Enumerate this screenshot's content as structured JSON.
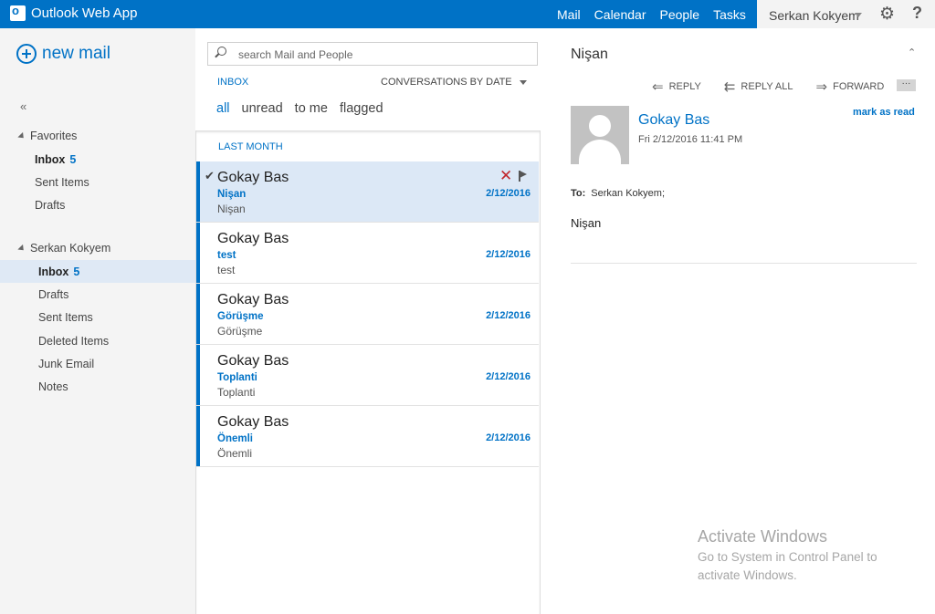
{
  "app": {
    "title": "Outlook Web App"
  },
  "nav": {
    "items": [
      "Mail",
      "Calendar",
      "People",
      "Tasks"
    ]
  },
  "user": {
    "name": "Serkan Kokyem"
  },
  "sidebar": {
    "new_mail": "new mail",
    "collapse": "«",
    "favorites": {
      "label": "Favorites",
      "items": [
        {
          "label": "Inbox",
          "count": "5"
        },
        {
          "label": "Sent Items"
        },
        {
          "label": "Drafts"
        }
      ]
    },
    "account": {
      "label": "Serkan Kokyem",
      "items": [
        {
          "label": "Inbox",
          "count": "5"
        },
        {
          "label": "Drafts"
        },
        {
          "label": "Sent Items"
        },
        {
          "label": "Deleted Items"
        },
        {
          "label": "Junk Email"
        },
        {
          "label": "Notes"
        }
      ]
    }
  },
  "search": {
    "placeholder": "search Mail and People"
  },
  "list_header": {
    "folder": "INBOX",
    "sort": "CONVERSATIONS BY DATE",
    "filters": [
      "all",
      "unread",
      "to me",
      "flagged"
    ]
  },
  "messages": {
    "group": "LAST MONTH",
    "items": [
      {
        "from": "Gokay Bas",
        "subject": "Nişan",
        "preview": "Nişan",
        "date": "2/12/2016"
      },
      {
        "from": "Gokay Bas",
        "subject": "test",
        "preview": "test",
        "date": "2/12/2016"
      },
      {
        "from": "Gokay Bas",
        "subject": "Görüşme",
        "preview": "Görüşme",
        "date": "2/12/2016"
      },
      {
        "from": "Gokay Bas",
        "subject": "Toplanti",
        "preview": "Toplanti",
        "date": "2/12/2016"
      },
      {
        "from": "Gokay Bas",
        "subject": "Önemli",
        "preview": "Önemli",
        "date": "2/12/2016"
      }
    ]
  },
  "reading": {
    "subject": "Nişan",
    "actions": {
      "reply": "REPLY",
      "reply_all": "REPLY ALL",
      "forward": "FORWARD",
      "more": "···"
    },
    "sender": "Gokay Bas",
    "date": "Fri 2/12/2016 11:41 PM",
    "mark_read": "mark as read",
    "to_label": "To:",
    "to_value": "Serkan Kokyem;",
    "body": "Nişan"
  },
  "watermark": {
    "title": "Activate Windows",
    "line": "Go to System in Control Panel to activate Windows."
  },
  "colors": {
    "accent": "#0072c6",
    "delete": "#c1272d"
  }
}
